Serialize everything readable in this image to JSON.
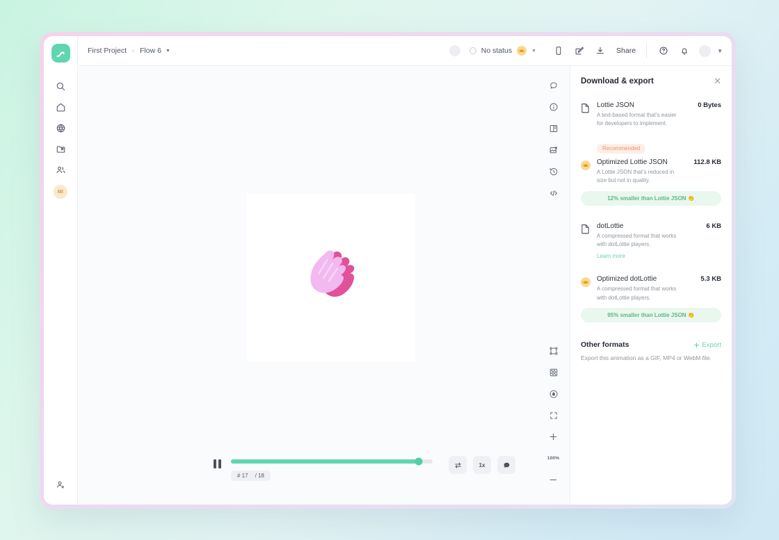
{
  "theme": {
    "accent_green": "#5fd6ae",
    "badge_peach": "#fdeee6",
    "badge_peach_text": "#f09070",
    "savings_green_bg": "#eaf7ef",
    "savings_green_text": "#5bb784",
    "crown_gold": "#fbd98b",
    "hand_light": "#f2b8f0",
    "hand_dark": "#e0529a",
    "window_border": "#eed9ef"
  },
  "rail": {
    "logo": "lottie-logo",
    "items": [
      {
        "icon": "search-icon",
        "name": "search"
      },
      {
        "icon": "home-icon",
        "name": "home"
      },
      {
        "icon": "globe-icon",
        "name": "discover"
      },
      {
        "icon": "folder-icon",
        "name": "projects"
      },
      {
        "icon": "users-icon",
        "name": "community"
      }
    ],
    "avatar_initials": "MI",
    "bottom_icon": "add-person-icon"
  },
  "topbar": {
    "breadcrumb": {
      "project": "First Project",
      "separator": "›",
      "file": "Flow 6"
    },
    "status": {
      "label": "No status",
      "badge_icon": "crown-icon"
    },
    "icons": [
      {
        "icon": "phone-icon",
        "name": "preview-device"
      },
      {
        "icon": "edit-icon",
        "name": "edit"
      },
      {
        "icon": "download-icon",
        "name": "download"
      }
    ],
    "share_label": "Share",
    "help_icon": "help-icon",
    "bell_icon": "bell-icon"
  },
  "canvas": {
    "tools_top": [
      {
        "icon": "comment-icon",
        "name": "comment"
      },
      {
        "icon": "info-icon",
        "name": "info"
      },
      {
        "icon": "theme-icon",
        "name": "theming"
      },
      {
        "icon": "image-icon",
        "name": "assets"
      },
      {
        "icon": "history-icon",
        "name": "version-history"
      },
      {
        "icon": "code-icon",
        "name": "embed-code"
      }
    ],
    "tools_bottom": [
      {
        "icon": "bounding-box-icon",
        "name": "bounding-box"
      },
      {
        "icon": "checkerboard-icon",
        "name": "transparency"
      },
      {
        "icon": "droplet-icon",
        "name": "background-color"
      },
      {
        "icon": "fullscreen-icon",
        "name": "fullscreen"
      },
      {
        "icon": "plus-icon",
        "name": "zoom-in"
      }
    ],
    "zoom_level": "100%",
    "zoom_out_icon": "minus-icon"
  },
  "playback": {
    "state_icon": "pause-icon",
    "progress_percent": 93,
    "frame_prefix": "# 17",
    "frame_total": "/ 18",
    "loop_icon": "loop-icon",
    "speed_label": "1x",
    "comment_icon": "comment-bubble-icon"
  },
  "panel": {
    "title": "Download & export",
    "close_icon": "close-icon",
    "formats": [
      {
        "icon": "file-icon",
        "name": "Lottie JSON",
        "size": "0 Bytes",
        "description": "A text-based format that’s easier for developers to implement."
      },
      {
        "icon": "crown-icon",
        "badge": "Recommended",
        "name": "Optimized Lottie JSON",
        "size": "112.8 KB",
        "description": "A Lottie JSON that’s reduced in size but not in quality.",
        "savings": "12% smaller than Lottie JSON 👏"
      },
      {
        "icon": "file-icon",
        "name": "dotLottie",
        "size": "6 KB",
        "description": "A compressed format that works with dotLottie players.",
        "link": "Learn more"
      },
      {
        "icon": "crown-icon",
        "name": "Optimized dotLottie",
        "size": "5.3 KB",
        "description": "A compressed format that works with dotLottie players.",
        "savings": "95% smaller than Lottie JSON 👏"
      }
    ],
    "other": {
      "title": "Other formats",
      "export_label": "Export",
      "export_icon": "plus-icon",
      "description": "Export this animation as a GIF, MP4 or WebM file."
    }
  }
}
